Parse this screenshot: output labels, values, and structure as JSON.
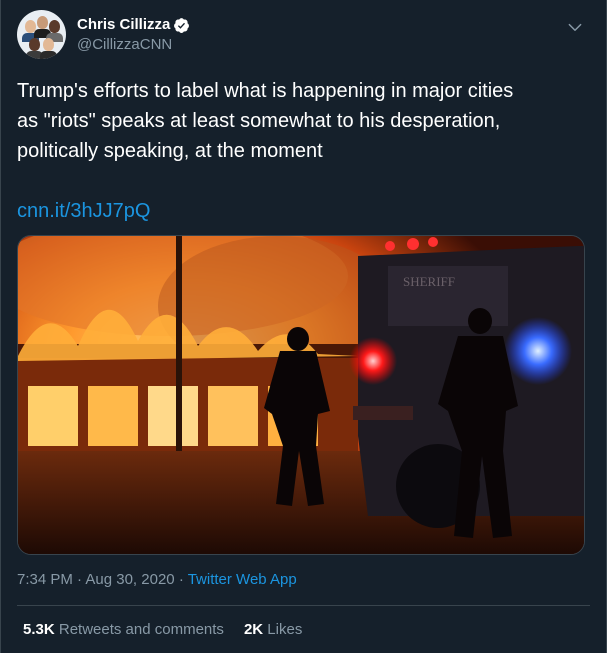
{
  "author": {
    "display_name": "Chris Cillizza",
    "handle": "@CillizzaCNN",
    "verified": true,
    "avatar_icon": "group-portrait-avatar"
  },
  "tweet": {
    "text": "Trump's efforts to label what is happening in major cities\nas \"riots\" speaks at least somewhat to his desperation,\npolitically speaking, at the moment",
    "link": "cnn.it/3hJJ7pQ",
    "photo_watermark": "SHERIFF",
    "time": "7:34 PM",
    "separator": "·",
    "date": "Aug 30, 2020",
    "source_app": "Twitter Web App"
  },
  "stats": {
    "retweets_count": "5.3K",
    "retweets_label": "Retweets and comments",
    "likes_count": "2K",
    "likes_label": "Likes"
  },
  "colors": {
    "background": "#15202b",
    "text_primary": "#ffffff",
    "text_secondary": "#8899a6",
    "link": "#1b95e0",
    "verified_badge": "#ffffff",
    "border": "#38444d"
  },
  "icons": {
    "verified": "verified-badge-icon",
    "menu": "chevron-down-icon"
  }
}
